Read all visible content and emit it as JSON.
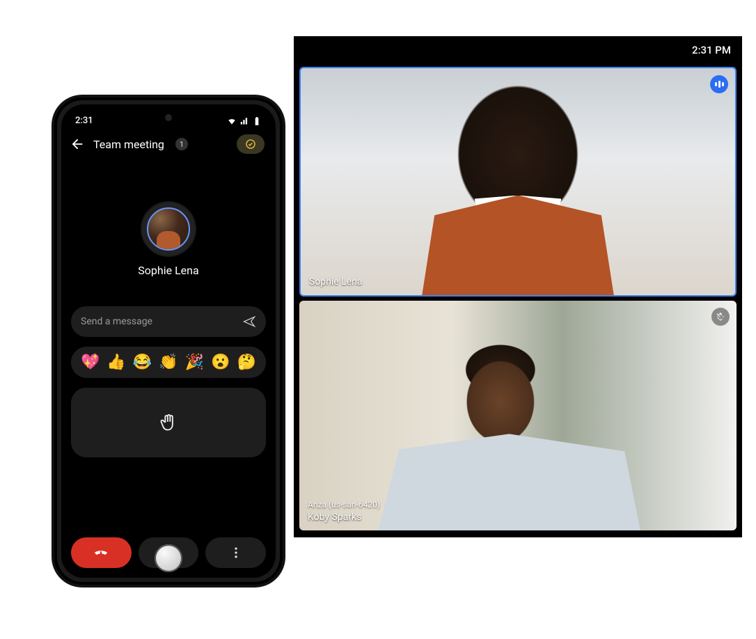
{
  "phone": {
    "status": {
      "time": "2:31"
    },
    "header": {
      "title": "Team meeting",
      "participant_badge": "1"
    },
    "speaker": {
      "name": "Sophie Lena"
    },
    "message": {
      "placeholder": "Send a message"
    },
    "reactions": [
      "💖",
      "👍",
      "😂",
      "👏",
      "🎉",
      "😮",
      "🤔"
    ],
    "actions": {
      "hangup": "End call",
      "cc": "Captions",
      "more": "More"
    }
  },
  "tablet": {
    "status": {
      "time": "2:31 PM"
    },
    "tiles": [
      {
        "name": "Sophie Lena",
        "indicator": "speaking",
        "active": true,
        "location": null
      },
      {
        "name": "Koby Sparks",
        "location": "Anza (us-san-6420)",
        "indicator": "muted",
        "active": false
      }
    ]
  }
}
